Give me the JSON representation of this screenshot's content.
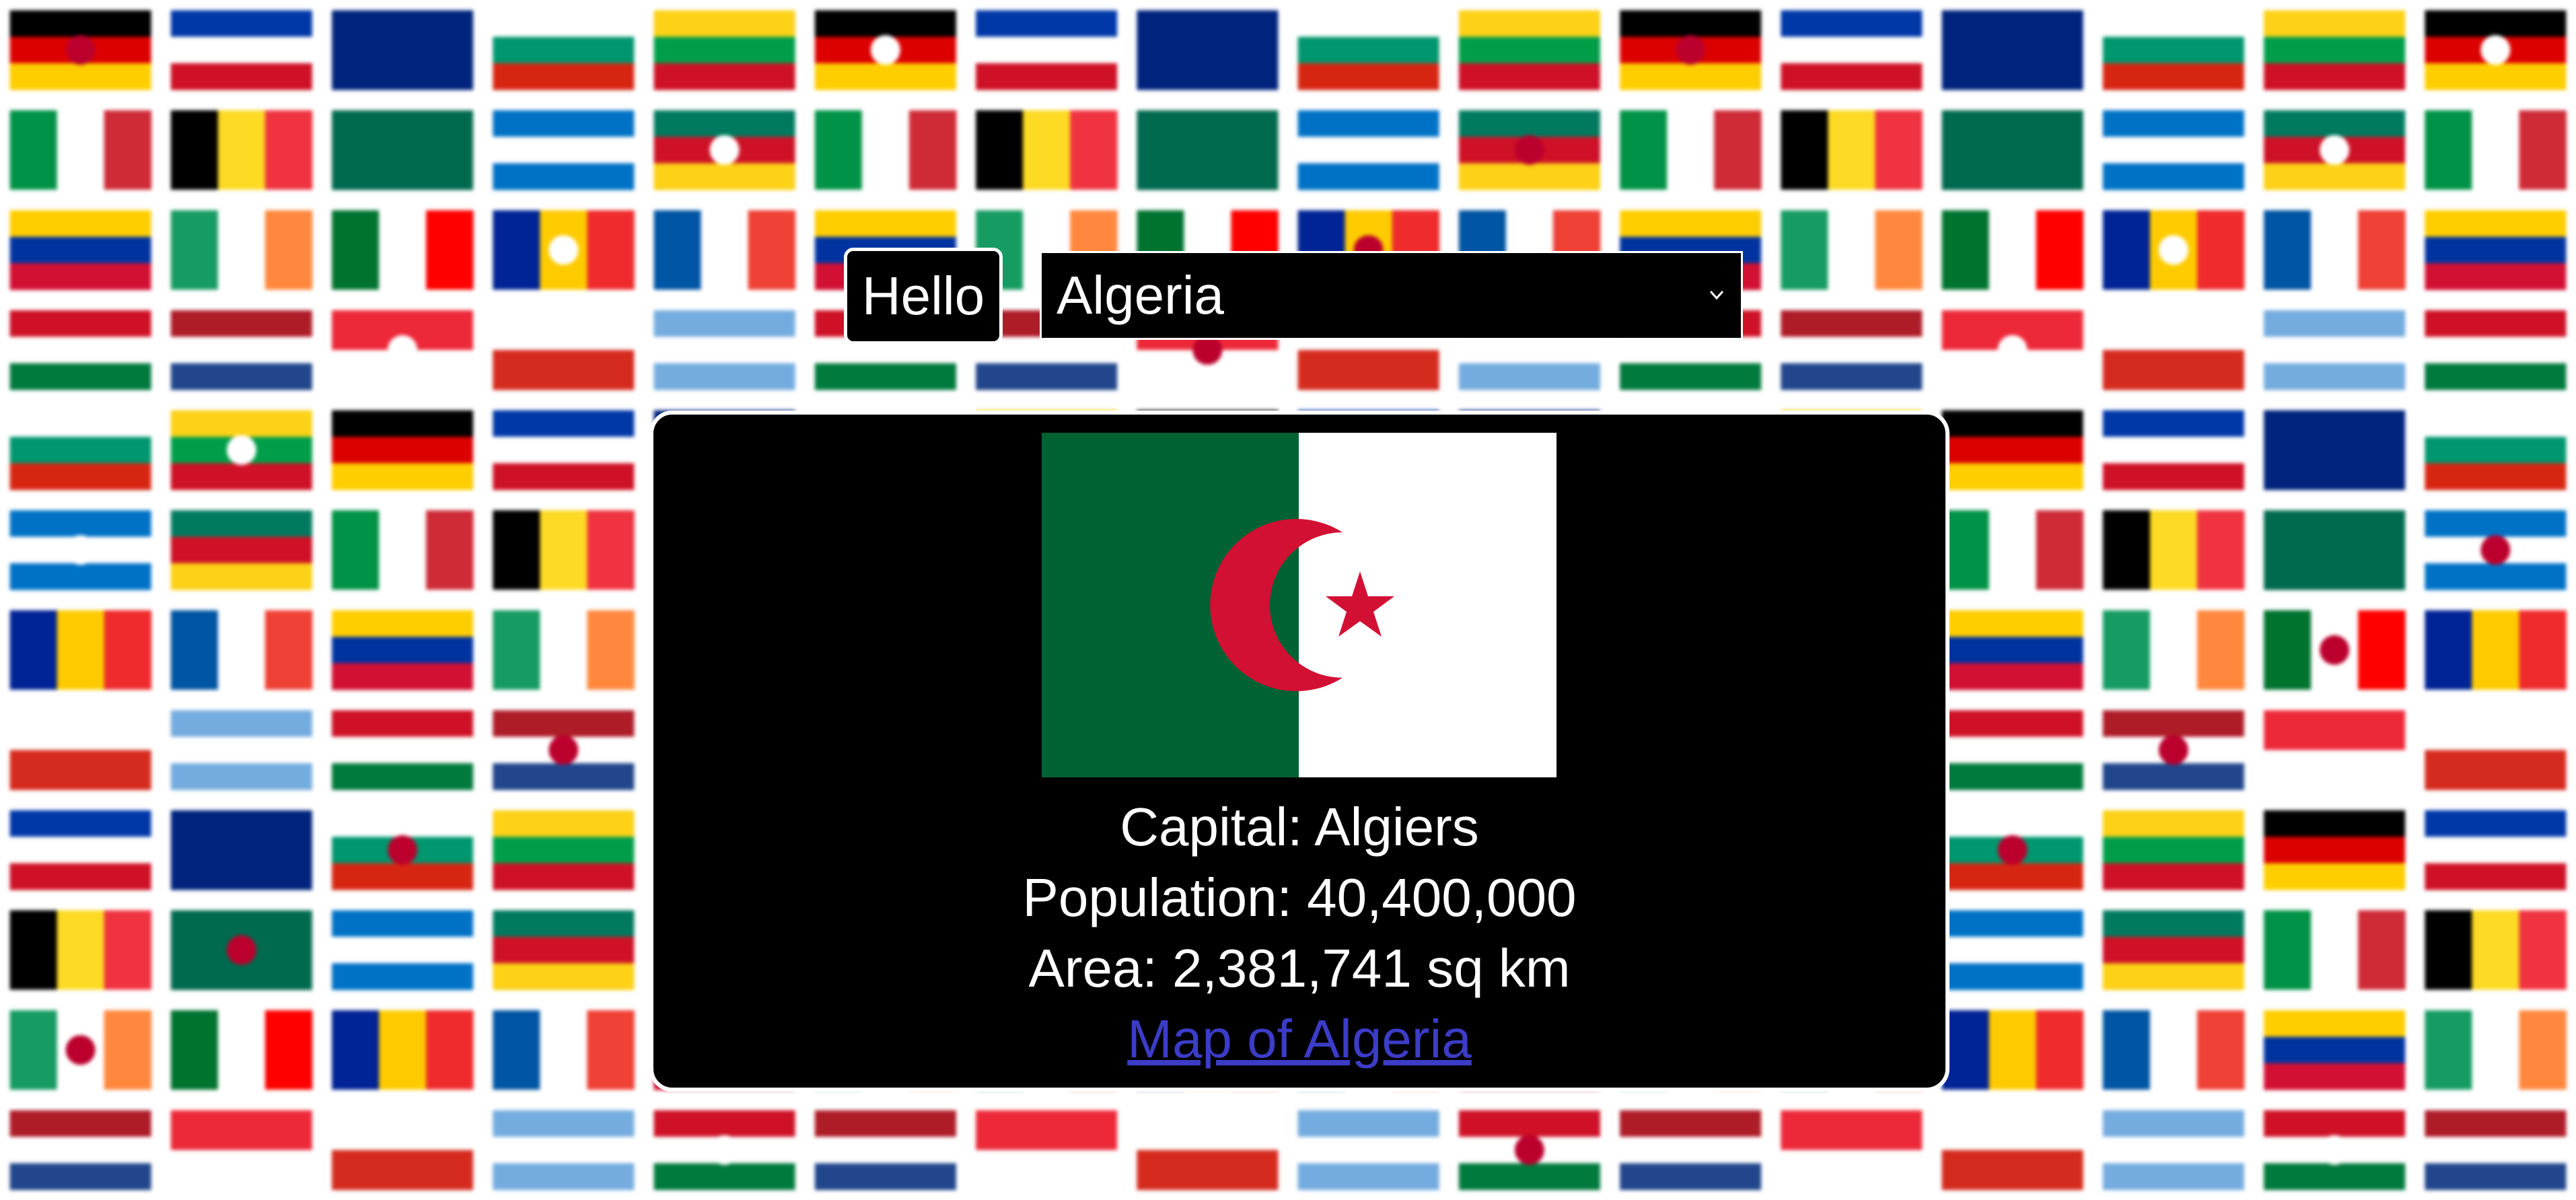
{
  "greeting_button": {
    "label": "Hello"
  },
  "country_select": {
    "selected": "Algeria"
  },
  "country_info": {
    "name": "Algeria",
    "capital_label": "Capital:",
    "capital": "Algiers",
    "population_label": "Population:",
    "population": "40,400,000",
    "area_label": "Area:",
    "area": "2,381,741",
    "area_unit": "sq km",
    "map_link": "Map of Algeria"
  },
  "colors": {
    "algeria_green": "#006233",
    "algeria_red": "#d21034",
    "link_blue": "#3c3cc8",
    "card_background": "#000000"
  },
  "icons": {
    "dropdown": "chevron-down-icon",
    "flag": "algeria-flag-icon"
  }
}
